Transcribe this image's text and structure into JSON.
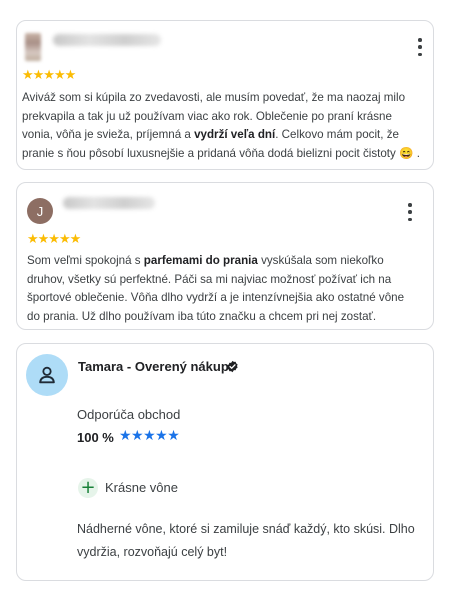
{
  "reviews": [
    {
      "rating_stars": "★★★★★",
      "text_before": "Aviváž som si kúpila zo zvedavosti, ale musím povedať, že ma naozaj milo prekvapila a tak ju už používam viac ako rok. Oblečenie po praní krásne vonia, vôňa je svieža, príjemná a ",
      "text_bold": "vydrží veľa dní",
      "text_after": ". Celkovo mám pocit, že pranie s ňou pôsobí luxusnejšie a pridaná vôňa dodá bielizni pocit čistoty 😄 ."
    },
    {
      "avatar_letter": "J",
      "rating_stars": "★★★★★",
      "text_before": "Som veľmi spokojná s ",
      "text_bold": "parfemami do prania",
      "text_after": " vyskúšala som niekoľko druhov, všetky sú perfektné. Páči sa mi najviac možnosť požívať ich na športové oblečenie. Vôňa dlho vydrží a je intenzívnejšia ako ostatné vône do prania. Už dlho používam iba túto značku a chcem pri nej zostať."
    },
    {
      "reviewer_name": "Tamara - Overený nákup",
      "recommend_label": "Odporúča obchod",
      "recommend_percent": "100 %",
      "rating_stars": "★★★★★",
      "tag_label": "Krásne vône",
      "text": "Nádherné vône, ktoré si zamiluje snáď každý, kto skúsi. Dlho vydržia, rozvoňajú celý byt!"
    }
  ],
  "colors": {
    "gold_star": "#fbbc04",
    "blue_star": "#1a73e8",
    "avatar_brown": "#8d6e63",
    "avatar_light_blue": "#aedcf7",
    "tag_green": "#188038"
  }
}
